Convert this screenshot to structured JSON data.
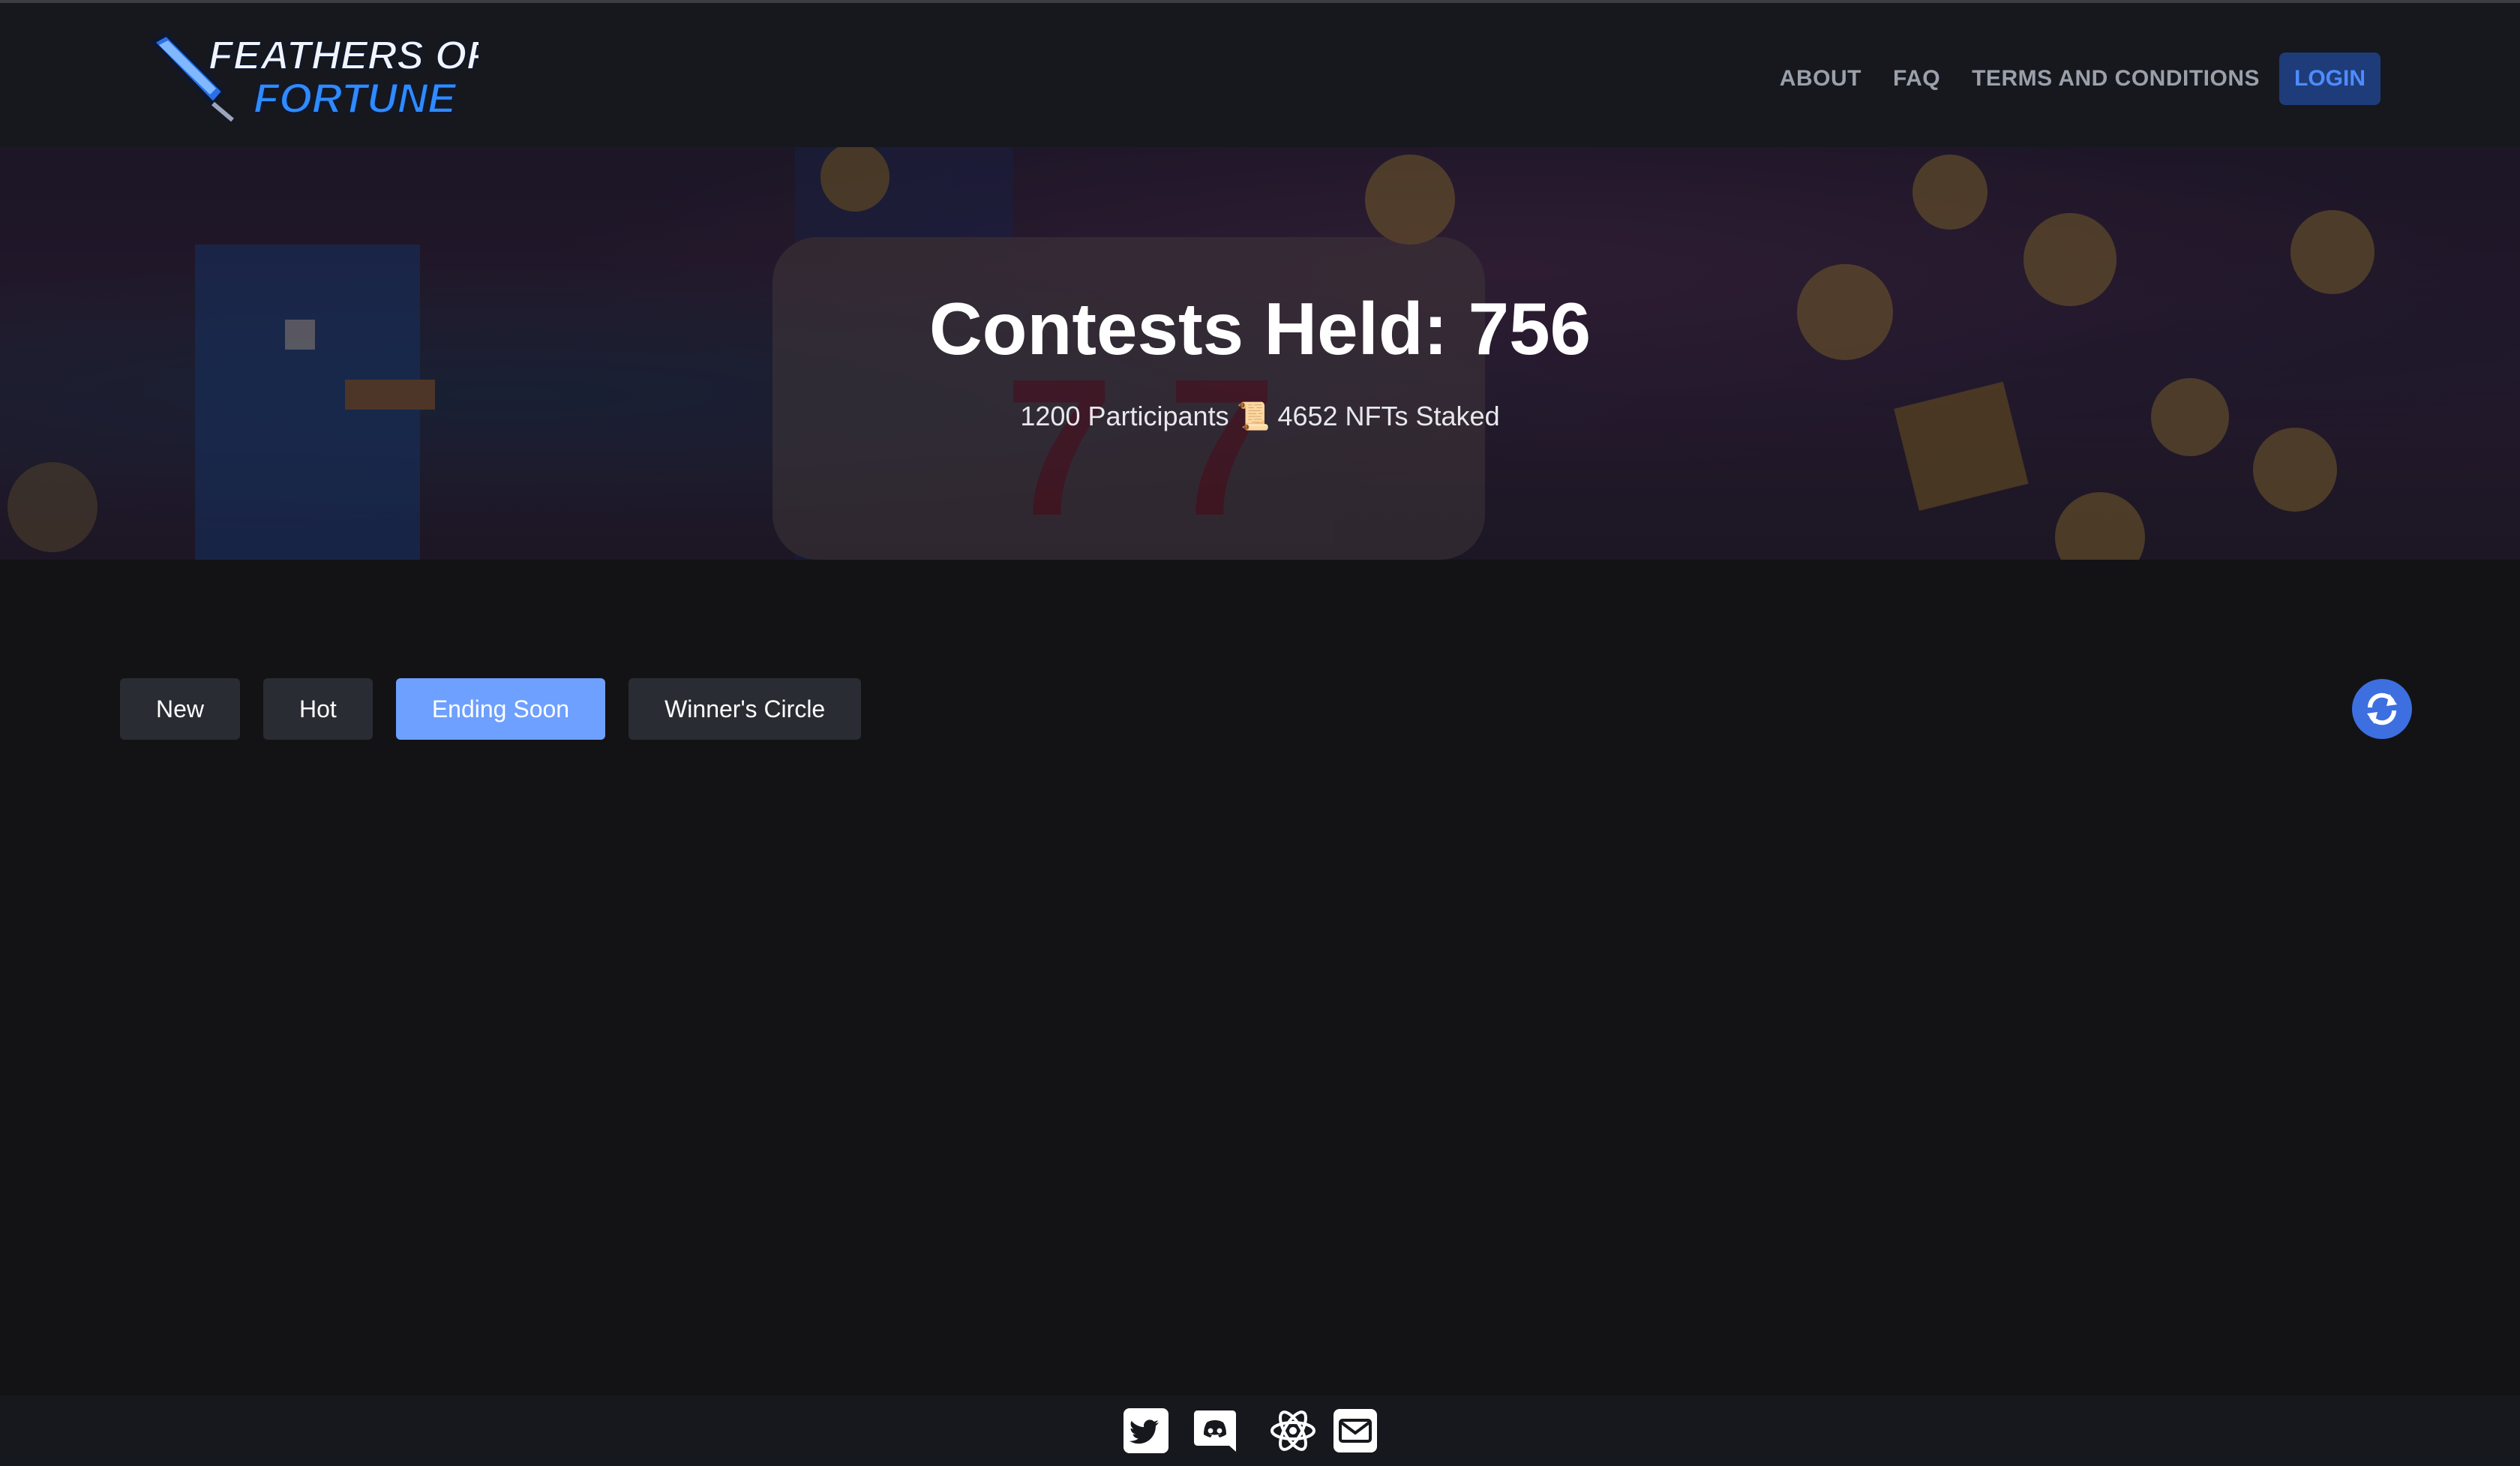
{
  "brand": {
    "line1": "FEATHERS OF",
    "line2": "FORTUNE"
  },
  "nav": {
    "about": "ABOUT",
    "faq": "FAQ",
    "terms": "TERMS AND CONDITIONS",
    "login": "LOGIN"
  },
  "hero": {
    "title": "Contests Held: 756",
    "participants": "1200 Participants",
    "separator": "📜",
    "staked": "4652 NFTs Staked"
  },
  "tabs": [
    {
      "label": "New",
      "active": false
    },
    {
      "label": "Hot",
      "active": false
    },
    {
      "label": "Ending Soon",
      "active": true
    },
    {
      "label": "Winner's Circle",
      "active": false
    }
  ],
  "icons": {
    "refresh": "refresh-icon",
    "twitter": "twitter-icon",
    "discord": "discord-icon",
    "atom": "atom-icon",
    "email": "email-icon"
  },
  "colors": {
    "accent": "#6ea0ff",
    "login_bg": "#1f3c7a",
    "refresh_bg": "#3d6fe0",
    "background": "#131315"
  }
}
